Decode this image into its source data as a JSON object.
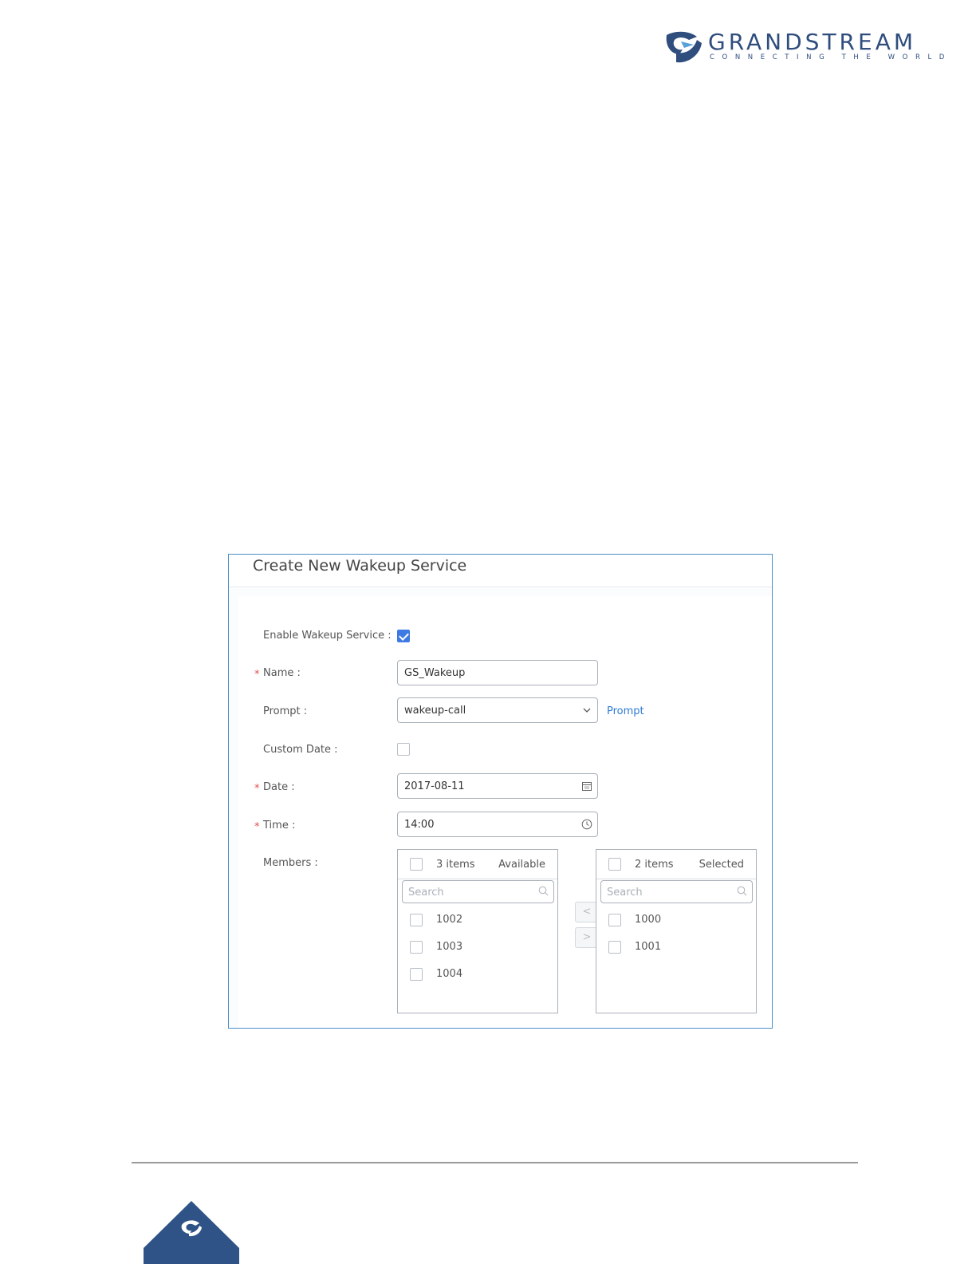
{
  "brand": {
    "name": "GRANDSTREAM",
    "tagline": "CONNECTING THE WORLD",
    "color": "#2f4d7d"
  },
  "dialog": {
    "title": "Create New Wakeup Service",
    "fields": {
      "enable": {
        "label": "Enable Wakeup Service :",
        "checked": true
      },
      "name": {
        "label": "Name :",
        "required_mark": "*",
        "value": "GS_Wakeup"
      },
      "prompt": {
        "label": "Prompt :",
        "value": "wakeup-call",
        "link": "Prompt"
      },
      "custom_date": {
        "label": "Custom Date :",
        "checked": false
      },
      "date": {
        "label": "Date :",
        "required_mark": "*",
        "value": "2017-08-11"
      },
      "time": {
        "label": "Time :",
        "required_mark": "*",
        "value": "14:00"
      },
      "members": {
        "label": "Members :"
      }
    },
    "members": {
      "available": {
        "count": "3 items",
        "title": "Available",
        "search_placeholder": "Search",
        "items": [
          "1002",
          "1003",
          "1004"
        ]
      },
      "selected": {
        "count": "2 items",
        "title": "Selected",
        "search_placeholder": "Search",
        "items": [
          "1000",
          "1001"
        ]
      },
      "move_left": "<",
      "move_right": ">"
    }
  },
  "colors": {
    "accent": "#3d7ae4",
    "dialog_border": "#4a90c8",
    "required": "#e34d4d",
    "link": "#2f7bd4"
  }
}
